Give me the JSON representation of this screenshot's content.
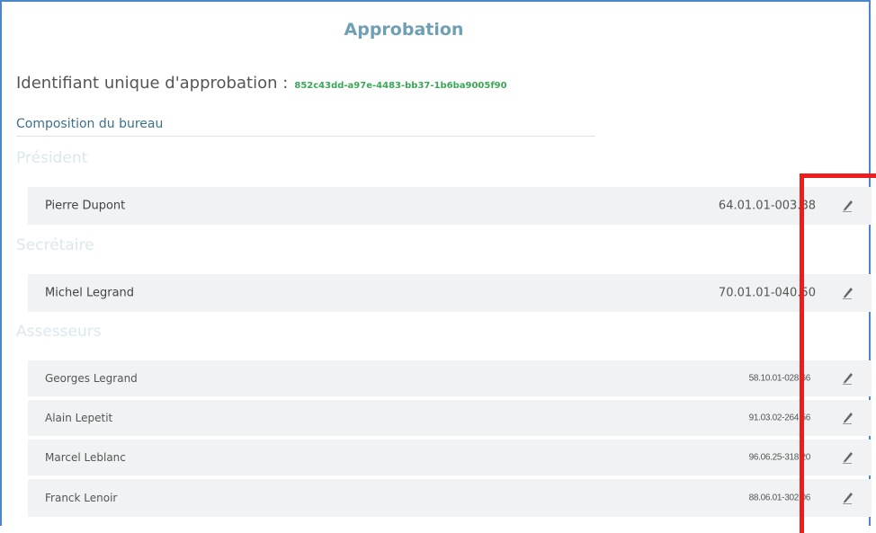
{
  "page": {
    "title": "Approbation",
    "uid_label": "Identifiant unique d'approbation :",
    "uid_value": "852c43dd-a97e-4483-bb37-1b6ba9005f90",
    "composition_label": "Composition du bureau"
  },
  "sections": {
    "president": {
      "title": "Président",
      "member": {
        "name": "Pierre Dupont",
        "code": "64.01.01-003.88"
      }
    },
    "secretaire": {
      "title": "Secrétaire",
      "member": {
        "name": "Michel Legrand",
        "code": "70.01.01-040.50"
      }
    },
    "assesseurs": {
      "title": "Assesseurs",
      "members": [
        {
          "name": "Georges Legrand",
          "code": "58.10.01-028.66"
        },
        {
          "name": "Alain Lepetit",
          "code": "91.03.02-264.56"
        },
        {
          "name": "Marcel Leblanc",
          "code": "96.06.25-318.20"
        },
        {
          "name": "Franck Lenoir",
          "code": "88.06.01-302.06"
        }
      ]
    }
  },
  "icons": {
    "edit": "pencil-icon"
  },
  "colors": {
    "title": "#6f9fb5",
    "uid": "#3aa757",
    "section_title": "#dbe7ef",
    "row_bg": "#f0f2f3",
    "frame_border": "#4a86c8",
    "highlight": "#ee1c1c"
  }
}
